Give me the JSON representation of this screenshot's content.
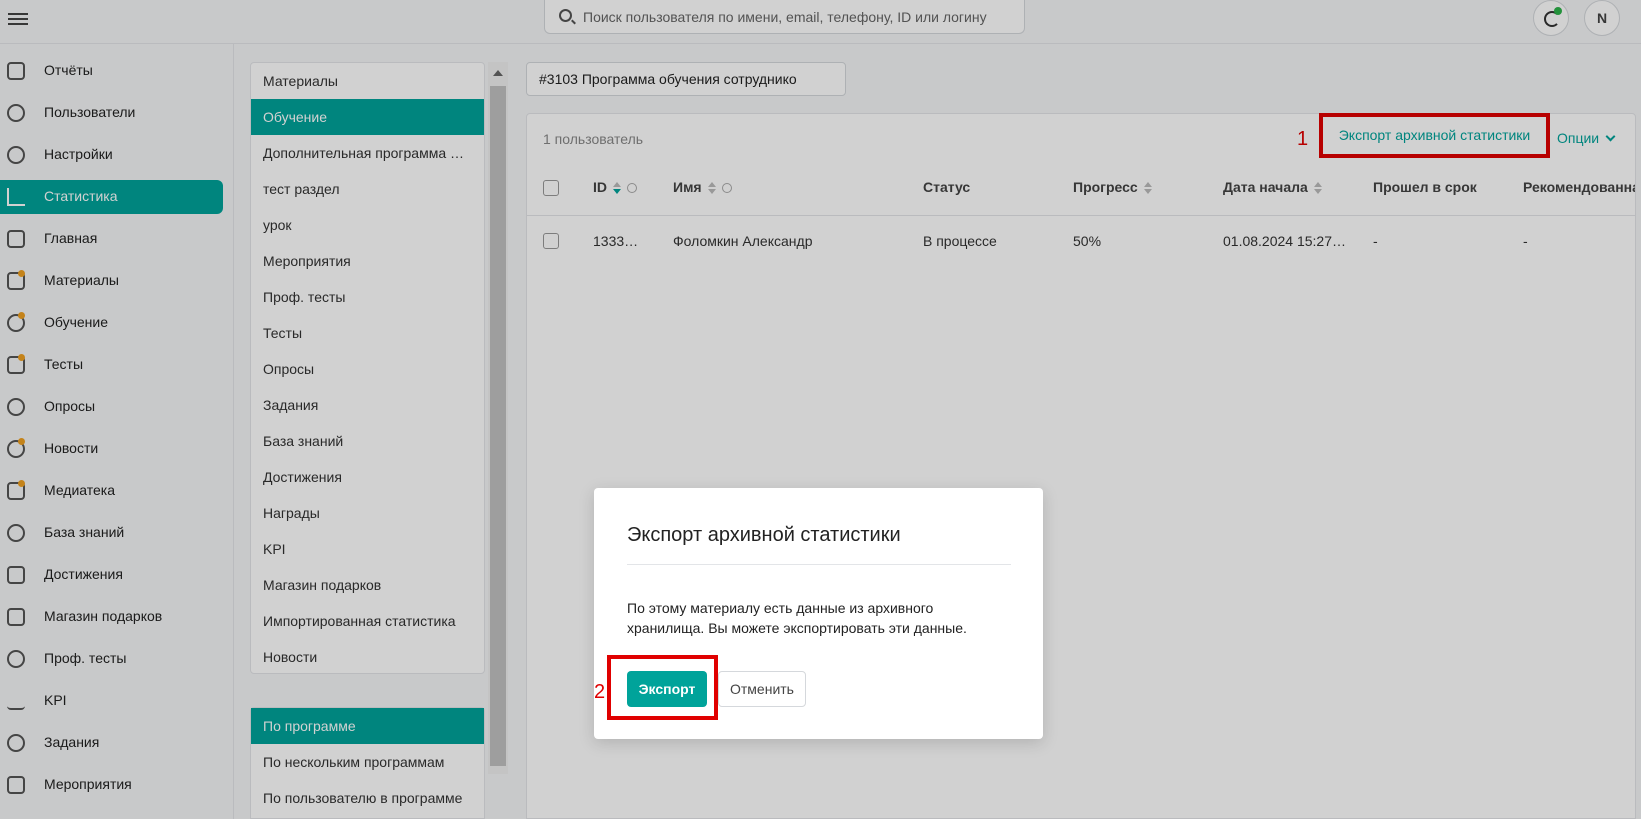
{
  "search": {
    "placeholder": "Поиск пользователя по имени, email, телефону, ID или логину"
  },
  "user": {
    "initial": "N"
  },
  "sidebar": {
    "items": [
      {
        "label": "Отчёты",
        "icon": "report-icon"
      },
      {
        "label": "Пользователи",
        "icon": "users-icon"
      },
      {
        "label": "Настройки",
        "icon": "gear-icon"
      },
      {
        "label": "Статистика",
        "icon": "chart-line-icon",
        "active": true
      },
      {
        "label": "Главная",
        "icon": "home-icon"
      },
      {
        "label": "Материалы",
        "icon": "materials-icon",
        "badge": true
      },
      {
        "label": "Обучение",
        "icon": "learning-icon",
        "badge": true
      },
      {
        "label": "Тесты",
        "icon": "tests-icon",
        "badge": true
      },
      {
        "label": "Опросы",
        "icon": "survey-icon"
      },
      {
        "label": "Новости",
        "icon": "news-icon",
        "badge": true
      },
      {
        "label": "Медиатека",
        "icon": "media-icon",
        "badge": true
      },
      {
        "label": "База знаний",
        "icon": "info-icon"
      },
      {
        "label": "Достижения",
        "icon": "trophy-icon"
      },
      {
        "label": "Магазин подарков",
        "icon": "gift-icon"
      },
      {
        "label": "Проф. тесты",
        "icon": "prof-test-icon"
      },
      {
        "label": "KPI",
        "icon": "trend-icon"
      },
      {
        "label": "Задания",
        "icon": "task-icon"
      },
      {
        "label": "Мероприятия",
        "icon": "calendar-icon"
      }
    ]
  },
  "submenu": {
    "items": [
      {
        "label": "Материалы"
      },
      {
        "label": "Обучение",
        "active": true
      },
      {
        "label": "Дополнительная программа обучения"
      },
      {
        "label": "тест раздел"
      },
      {
        "label": "урок"
      },
      {
        "label": "Мероприятия"
      },
      {
        "label": "Проф. тесты"
      },
      {
        "label": "Тесты"
      },
      {
        "label": "Опросы"
      },
      {
        "label": "Задания"
      },
      {
        "label": "База знаний"
      },
      {
        "label": "Достижения"
      },
      {
        "label": "Награды"
      },
      {
        "label": "KPI"
      },
      {
        "label": "Магазин подарков"
      },
      {
        "label": "Импортированная статистика"
      },
      {
        "label": "Новости"
      }
    ],
    "items2": [
      {
        "label": "По программе",
        "active": true
      },
      {
        "label": "По нескольким программам"
      },
      {
        "label": "По пользователю в программе"
      }
    ]
  },
  "main": {
    "program": "#3103 Программа обучения  сотруднико",
    "count": "1 пользователь",
    "export_link": "Экспорт архивной статистики",
    "options": "Опции",
    "marker1": "1",
    "marker2": "2",
    "columns": [
      "ID",
      "Имя",
      "Статус",
      "Прогресс",
      "Дата начала",
      "Прошел в срок",
      "Рекомендованная"
    ],
    "rows": [
      {
        "id": "1333…",
        "name": "Фоломкин Александр",
        "status": "В процессе",
        "progress": "50%",
        "start": "01.08.2024 15:27…",
        "on_time": "-",
        "recommended": "-"
      }
    ]
  },
  "modal": {
    "title": "Экспорт архивной статистики",
    "text": "По этому материалу есть данные из архивного хранилища. Вы можете экспортировать эти данные.",
    "export_label": "Экспорт",
    "cancel_label": "Отменить"
  },
  "colors": {
    "accent": "#00a39a",
    "highlight": "#e00000",
    "badge": "#f0a020"
  }
}
